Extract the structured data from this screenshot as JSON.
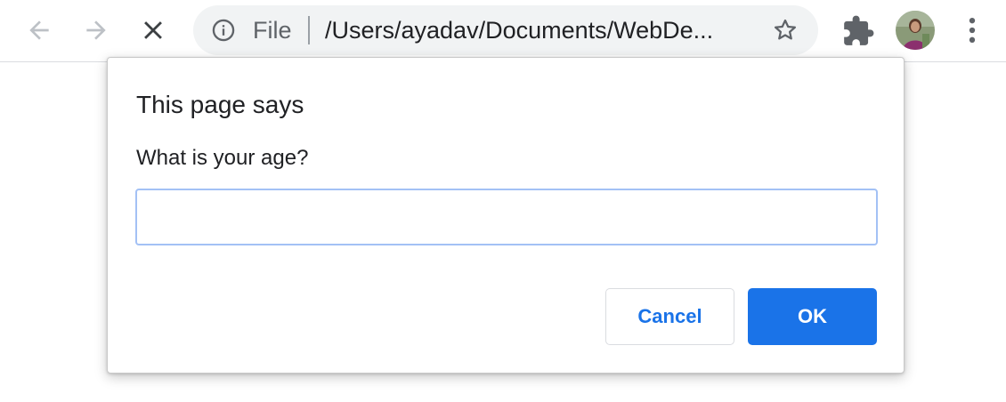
{
  "browser": {
    "back_label": "Back",
    "forward_label": "Forward",
    "stop_label": "Stop loading",
    "omnibox": {
      "scheme_label": "File",
      "url": "/Users/ayadav/Documents/WebDe..."
    },
    "icons": {
      "back": "arrow-left-icon",
      "forward": "arrow-right-icon",
      "stop": "close-icon",
      "info": "info-icon",
      "bookmark": "star-icon",
      "extensions": "puzzle-piece-icon",
      "menu": "more-vertical-icon"
    }
  },
  "dialog": {
    "title": "This page says",
    "message": "What is your age?",
    "input_value": "",
    "cancel_label": "Cancel",
    "ok_label": "OK"
  },
  "colors": {
    "accent": "#1a73e8",
    "input_focus": "#a3c1f5",
    "omnibox_bg": "#f1f3f4",
    "icon_gray": "#5f6368",
    "disabled_gray": "#bdc1c6"
  }
}
